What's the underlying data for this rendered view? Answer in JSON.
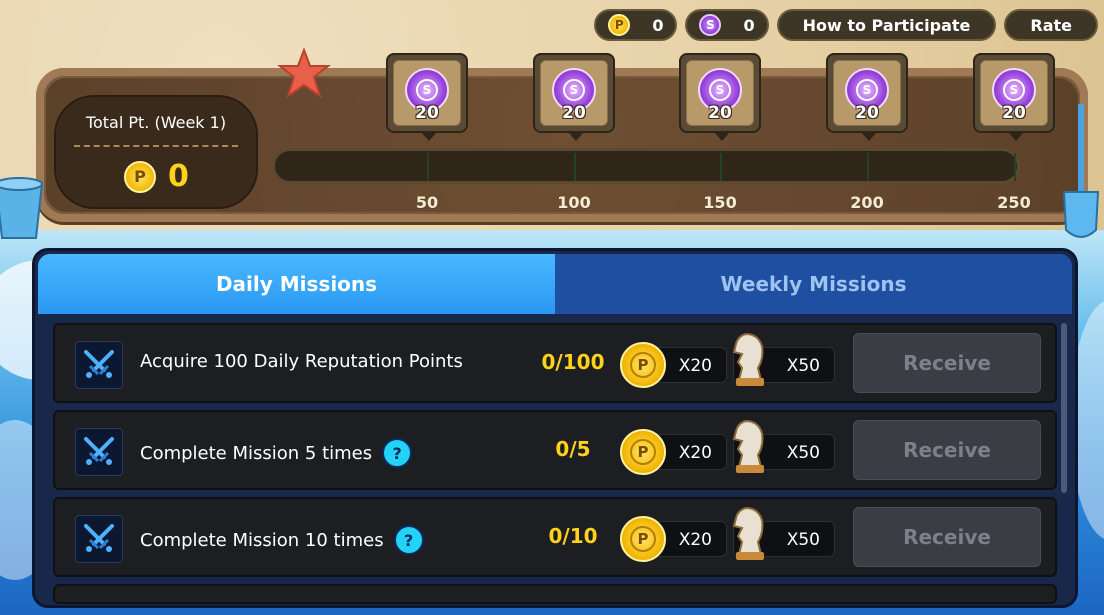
{
  "topbar": {
    "p_coin_count": "0",
    "s_coin_count": "0",
    "how_label": "How to Participate",
    "rate_label": "Rate",
    "p_symbol": "P",
    "s_symbol": "S"
  },
  "total": {
    "label": "Total Pt. (Week 1)",
    "value": "0"
  },
  "milestones": [
    {
      "threshold": "50",
      "reward": "20"
    },
    {
      "threshold": "100",
      "reward": "20"
    },
    {
      "threshold": "150",
      "reward": "20"
    },
    {
      "threshold": "200",
      "reward": "20"
    },
    {
      "threshold": "250",
      "reward": "20"
    }
  ],
  "progress_fraction": 0,
  "tabs": {
    "daily": "Daily Missions",
    "weekly": "Weekly Missions",
    "active": "daily"
  },
  "missions": [
    {
      "label": "Acquire 100 Daily Reputation Points",
      "progress": "0/100",
      "coin_amount": "X20",
      "knight_amount": "X50",
      "button": "Receive"
    },
    {
      "label": "Complete Mission 5 times",
      "progress": "0/5",
      "coin_amount": "X20",
      "knight_amount": "X50",
      "button": "Receive"
    },
    {
      "label": "Complete Mission 10 times",
      "progress": "0/10",
      "coin_amount": "X20",
      "knight_amount": "X50",
      "button": "Receive"
    }
  ],
  "colors": {
    "accent_gold": "#ffd21c",
    "tab_active": "#2a98f2",
    "tab_inactive": "#1f4fa0",
    "help_cyan": "#22d3f5"
  }
}
